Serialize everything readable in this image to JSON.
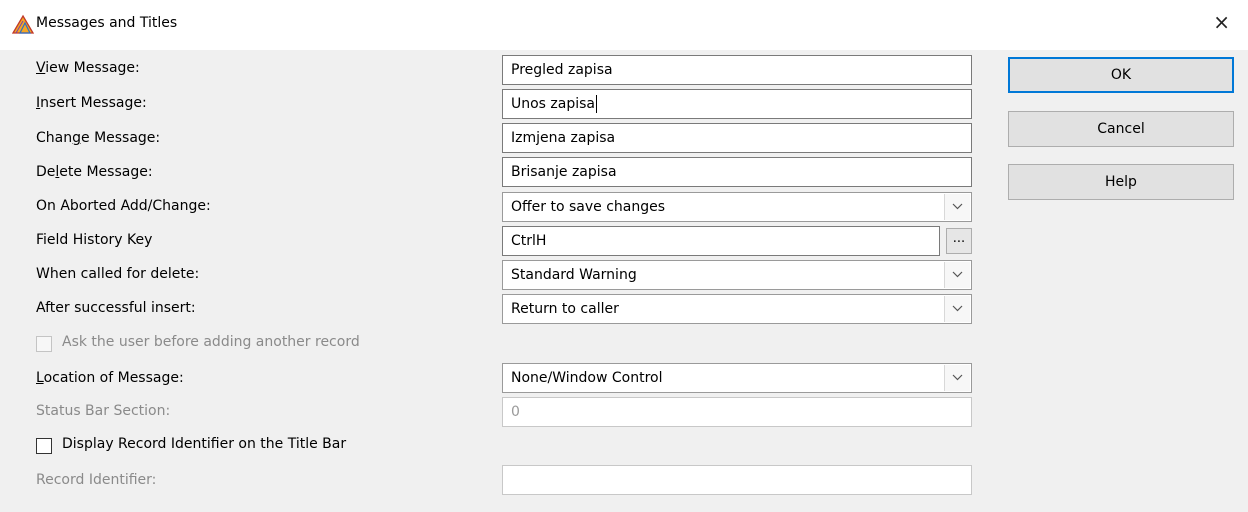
{
  "window": {
    "title": "Messages and Titles",
    "close_glyph": "×"
  },
  "fields": {
    "view_message": {
      "label": "View Message:",
      "value": "Pregled zapisa"
    },
    "insert_message": {
      "label": "Insert Message:",
      "value": "Unos zapisa"
    },
    "change_message": {
      "label": "Change Message:",
      "value": "Izmjena zapisa"
    },
    "delete_message": {
      "label": "Delete Message:",
      "value": "Brisanje zapisa"
    },
    "on_aborted": {
      "label": "On Aborted Add/Change:",
      "value": "Offer to save changes"
    },
    "field_history_key": {
      "label": "Field History Key",
      "value": "CtrlH",
      "button": "..."
    },
    "when_called_for_delete": {
      "label": "When called for delete:",
      "value": "Standard Warning"
    },
    "after_successful_insert": {
      "label": "After successful insert:",
      "value": "Return to caller"
    },
    "ask_user": {
      "label": "Ask the user before adding another record",
      "checked": false,
      "enabled": false
    },
    "location_of_message": {
      "label": "Location of Message:",
      "value": "None/Window Control"
    },
    "status_bar_section": {
      "label": "Status Bar Section:",
      "value": "0",
      "enabled": false
    },
    "display_record_identifier": {
      "label": "Display Record Identifier on the Title Bar",
      "checked": false
    },
    "record_identifier": {
      "label": "Record Identifier:",
      "value": "",
      "enabled": false
    }
  },
  "buttons": {
    "ok": "OK",
    "cancel": "Cancel",
    "help": "Help"
  },
  "icons": {
    "app": "app-triangle-icon",
    "close": "close-icon",
    "dropdown": "chevron-down-icon"
  },
  "colors": {
    "dialog_bg": "#f0f0f0",
    "titlebar_bg": "#ffffff",
    "default_button_border": "#0078d7",
    "disabled_text": "#8a8a8a"
  }
}
